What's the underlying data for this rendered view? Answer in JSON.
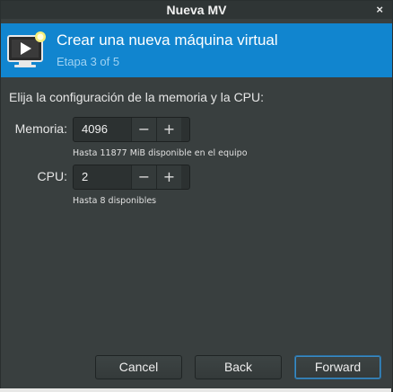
{
  "window": {
    "title": "Nueva MV",
    "close_glyph": "×"
  },
  "banner": {
    "title": "Crear una nueva máquina virtual",
    "step": "Etapa 3 of 5",
    "icon": "new-vm-monitor-icon",
    "color": "#1185cf"
  },
  "prompt": "Elija la configuración de la memoria y la CPU:",
  "memory": {
    "label": "Memoria:",
    "value": "4096",
    "hint": "Hasta 11877 MiB disponible en el equipo",
    "decrement": "−",
    "increment": "+"
  },
  "cpu": {
    "label": "CPU:",
    "value": "2",
    "hint": "Hasta 8 disponibles",
    "decrement": "−",
    "increment": "+"
  },
  "buttons": {
    "cancel": "Cancel",
    "back": "Back",
    "forward": "Forward"
  }
}
